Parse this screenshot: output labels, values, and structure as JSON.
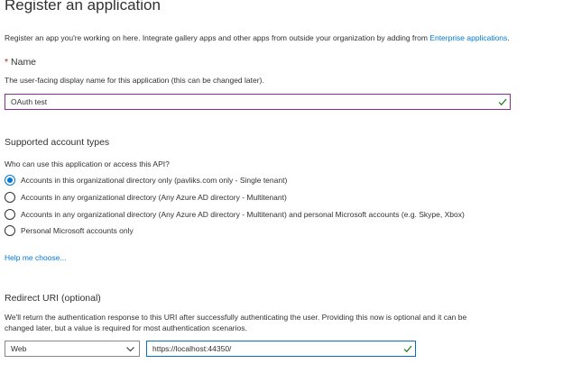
{
  "page": {
    "title": "Register an application",
    "intro_text": "Register an app you're working on here. Integrate gallery apps and other apps from outside your organization by adding from ",
    "intro_link": "Enterprise applications",
    "intro_end": "."
  },
  "name_field": {
    "required_marker": "*",
    "label": "Name",
    "description": "The user-facing display name for this application (this can be changed later).",
    "value": "OAuth test",
    "valid_icon": "check-icon"
  },
  "account_types": {
    "title": "Supported account types",
    "question": "Who can use this application or access this API?",
    "options": [
      {
        "label": "Accounts in this organizational directory only (pavliks.com only - Single tenant)",
        "selected": true
      },
      {
        "label": "Accounts in any organizational directory (Any Azure AD directory - Multitenant)",
        "selected": false
      },
      {
        "label": "Accounts in any organizational directory (Any Azure AD directory - Multitenant) and personal Microsoft accounts (e.g. Skype, Xbox)",
        "selected": false
      },
      {
        "label": "Personal Microsoft accounts only",
        "selected": false
      }
    ],
    "help_link": "Help me choose..."
  },
  "redirect": {
    "title": "Redirect URI (optional)",
    "description_line1": "We'll return the authentication response to this URI after successfully authenticating the user. Providing this now is optional and it can be",
    "description_line2": "changed later, but a value is required for most authentication scenarios.",
    "platform_selected": "Web",
    "uri_value": "https://localhost:44350/",
    "valid_icon": "check-icon"
  },
  "colors": {
    "accent": "#0078d4",
    "required": "#a4262c",
    "valid_check": "#107c10",
    "name_input_border": "#8a2d9a",
    "uri_input_border": "#0b6fc1"
  }
}
